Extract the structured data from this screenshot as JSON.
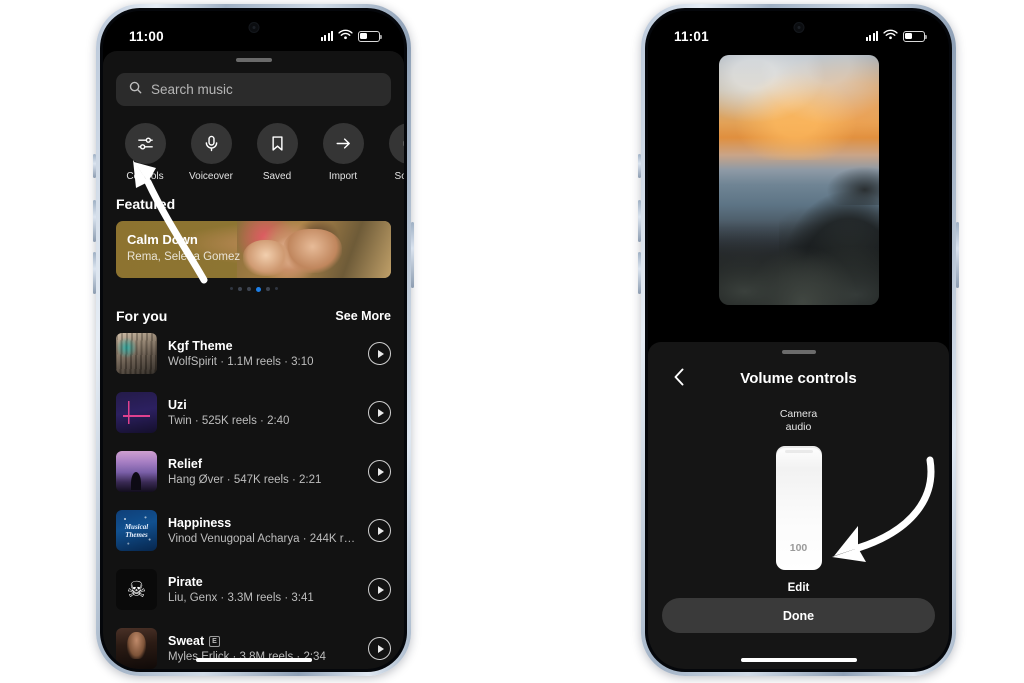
{
  "left_phone": {
    "status": {
      "time": "11:00",
      "signal_icon": "cellular-signal-icon",
      "wifi_icon": "wifi-icon",
      "battery_icon": "battery-icon"
    },
    "search": {
      "placeholder": "Search music",
      "icon": "search-icon"
    },
    "shortcuts": [
      {
        "label": "Controls",
        "icon": "sliders-icon"
      },
      {
        "label": "Voiceover",
        "icon": "microphone-icon"
      },
      {
        "label": "Saved",
        "icon": "bookmark-icon"
      },
      {
        "label": "Import",
        "icon": "arrow-right-icon"
      },
      {
        "label": "Sound",
        "icon": "speaker-icon"
      }
    ],
    "featured": {
      "heading": "Featured",
      "card": {
        "title": "Calm Down",
        "artist": "Rema, Selena Gomez"
      },
      "dots_total": 6,
      "dots_active_index": 3
    },
    "for_you": {
      "heading": "For you",
      "see_more": "See More",
      "tracks": [
        {
          "title": "Kgf Theme",
          "subtitle": "WolfSpirit · 1.1M reels · 3:10",
          "explicit": false,
          "art": "art-kgf"
        },
        {
          "title": "Uzi",
          "subtitle": "Twin · 525K reels · 2:40",
          "explicit": false,
          "art": "art-uzi"
        },
        {
          "title": "Relief",
          "subtitle": "Hang Øver · 547K reels · 2:21",
          "explicit": false,
          "art": "art-relief"
        },
        {
          "title": "Happiness",
          "subtitle": "Vinod Venugopal Acharya · 244K ree...",
          "explicit": false,
          "art": "art-happiness"
        },
        {
          "title": "Pirate",
          "subtitle": "Liu, Genx · 3.3M reels · 3:41",
          "explicit": false,
          "art": "art-pirate"
        },
        {
          "title": "Sweat",
          "subtitle": "Myles Erlick · 3.8M reels · 2:34",
          "explicit": true,
          "art": "art-sweat"
        }
      ],
      "explicit_badge": "E"
    }
  },
  "right_phone": {
    "status": {
      "time": "11:01",
      "signal_icon": "cellular-signal-icon",
      "wifi_icon": "wifi-icon",
      "battery_icon": "battery-icon"
    },
    "preview": {
      "name": "video-preview-thumbnail"
    },
    "volume_controls": {
      "back_icon": "chevron-left-icon",
      "title": "Volume controls",
      "channel_label_line1": "Camera",
      "channel_label_line2": "audio",
      "slider_value": "100",
      "edit_label": "Edit",
      "done_label": "Done"
    }
  },
  "annotations": {
    "arrow_left": "curved-arrow-pointing-to-controls",
    "arrow_right": "curved-arrow-pointing-to-volume-slider"
  },
  "colors": {
    "accent_blue": "#1d7fe8",
    "sheet_bg": "#121212",
    "search_bg": "#2b2b2b",
    "bubble_bg": "#353535",
    "done_bg": "#3a3a3a"
  }
}
